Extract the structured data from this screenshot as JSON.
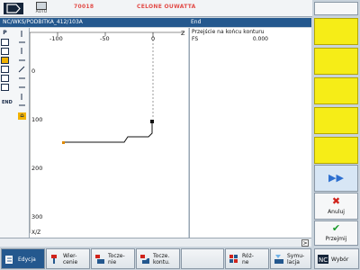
{
  "status_bar": {
    "mode": "AUTO",
    "alarm_1": "70018",
    "alarm_2": "CELONE OUWATTA"
  },
  "title_bar": {
    "path": "NC/WKS/PODBITKA_412/103A",
    "param_title": "End"
  },
  "params": {
    "description": "Przejście na końcu konturu",
    "field_label": "FS",
    "field_value": "0.000"
  },
  "graphic": {
    "x_ticks": [
      "-100",
      "-50",
      "0"
    ],
    "x_axis_label": "Z",
    "y_ticks": [
      "0",
      "100",
      "200",
      "300"
    ],
    "axes_label": "X/Z"
  },
  "strip": {
    "p_label": "P",
    "end_label": "END"
  },
  "bottom_bar": {
    "more_symbol": ">"
  },
  "horizontal_softkeys": [
    {
      "label": "Edycja",
      "icon": "edit-icon"
    },
    {
      "label": "Wier-\ncenie",
      "icon": "drill-icon"
    },
    {
      "label": "Tocze-\nnie",
      "icon": "turning-icon"
    },
    {
      "label": "Tocze.\nkontu.",
      "icon": "contour-turning-icon"
    },
    {
      "label": "",
      "icon": ""
    },
    {
      "label": "Róż-\nne",
      "icon": "misc-icon"
    },
    {
      "label": "Symu-\nlacja",
      "icon": "simulation-icon"
    },
    {
      "label": "Wybór",
      "icon": "nc-icon"
    }
  ],
  "vertical_softkeys": {
    "forward_symbol": "▶▶",
    "cancel": "Anuluj",
    "accept": "Przejmij"
  },
  "colors": {
    "title_bar": "#24588e",
    "softkey_yellow": "#f6ed17",
    "cancel_red": "#d0231b",
    "accept_green": "#1b9b2c",
    "highlight": "#f2b200"
  }
}
